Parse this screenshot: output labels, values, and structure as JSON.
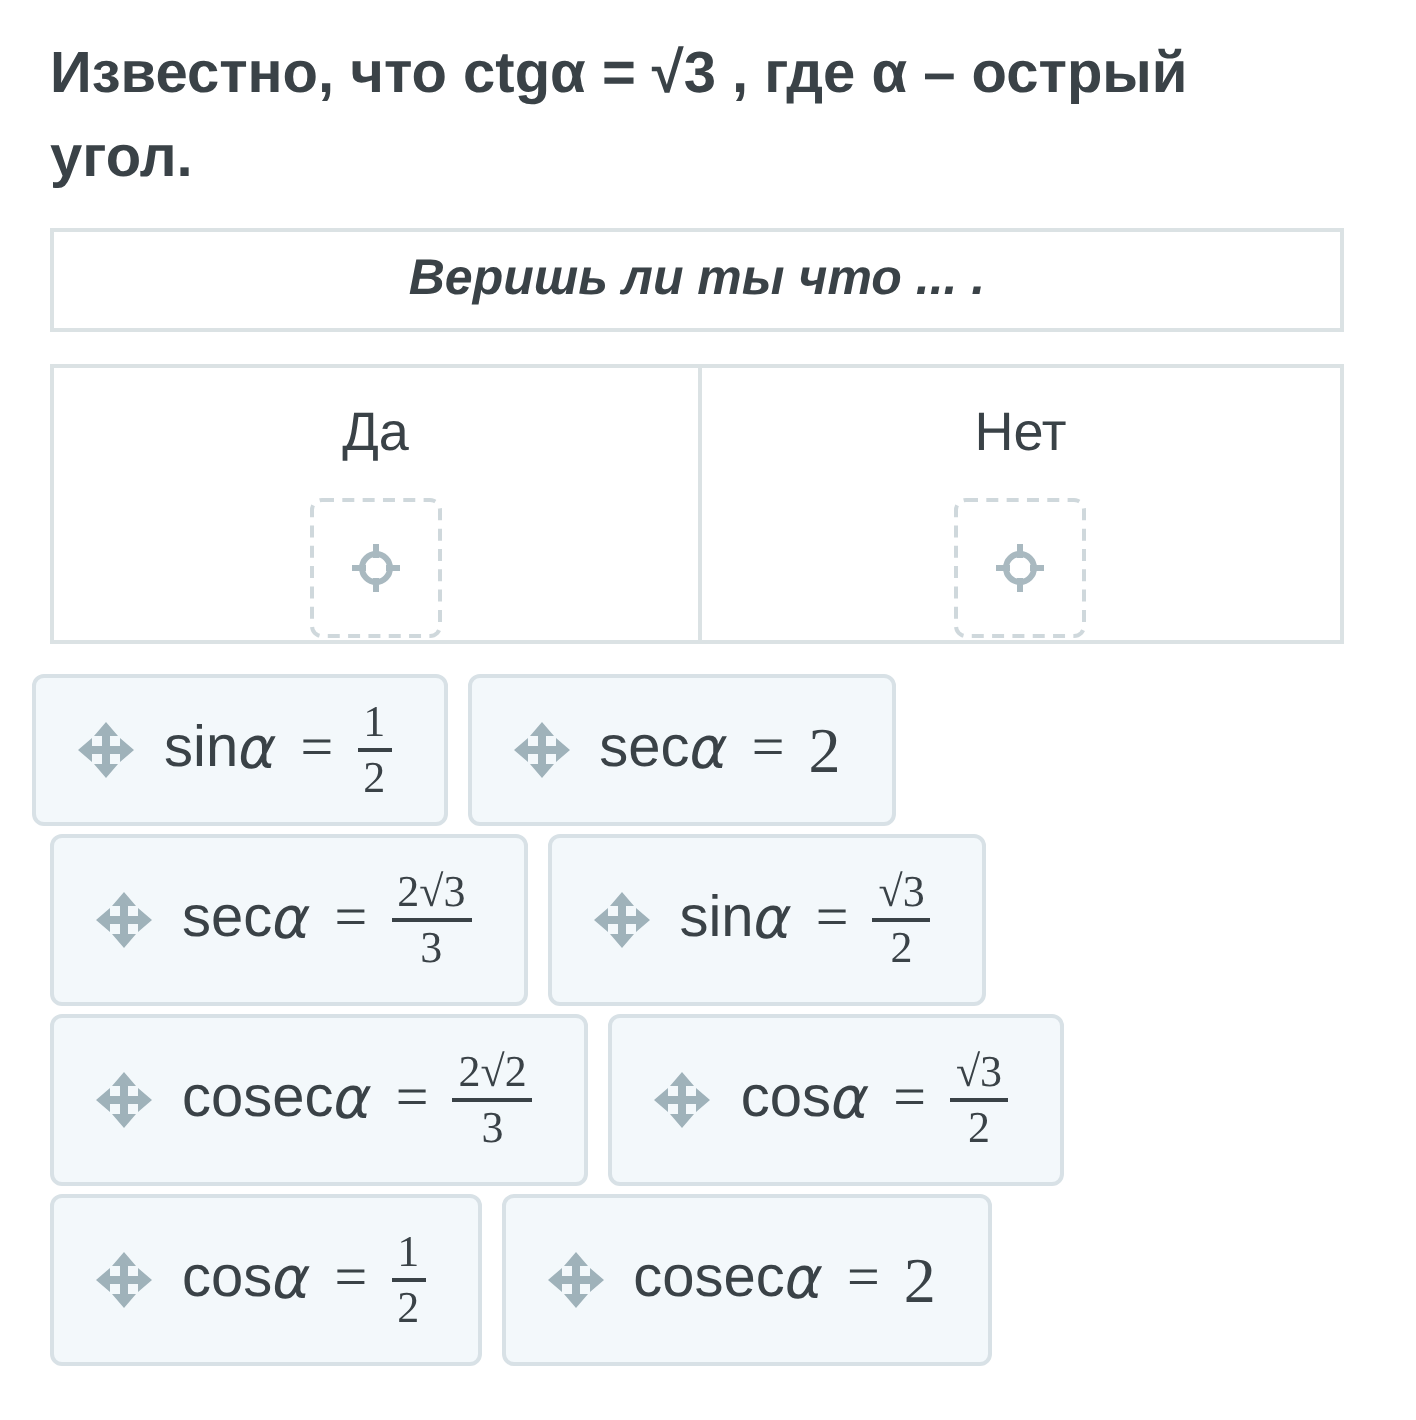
{
  "question": "Известно, что ctgα = √3 , где α – острый угол.",
  "prompt": "Веришь ли ты что ... .",
  "columns": [
    {
      "label": "Да"
    },
    {
      "label": "Нет"
    }
  ],
  "cards": [
    {
      "func": "sin",
      "var": "α",
      "rel": "=",
      "rhs": {
        "kind": "fraction",
        "numerator": "1",
        "denominator": "2"
      }
    },
    {
      "func": "sec",
      "var": "α",
      "rel": "=",
      "rhs": {
        "kind": "number",
        "text": "2"
      }
    },
    {
      "func": "sec",
      "var": "α",
      "rel": "=",
      "rhs": {
        "kind": "fraction",
        "numerator": "2√3",
        "denominator": "3"
      }
    },
    {
      "func": "sin",
      "var": "α",
      "rel": "=",
      "rhs": {
        "kind": "fraction",
        "numerator": "√3",
        "denominator": "2"
      }
    },
    {
      "func": "cosec",
      "var": "α",
      "rel": "=",
      "rhs": {
        "kind": "fraction",
        "numerator": "2√2",
        "denominator": "3"
      }
    },
    {
      "func": "cos",
      "var": "α",
      "rel": "=",
      "rhs": {
        "kind": "fraction",
        "numerator": "√3",
        "denominator": "2"
      }
    },
    {
      "func": "cos",
      "var": "α",
      "rel": "=",
      "rhs": {
        "kind": "fraction",
        "numerator": "1",
        "denominator": "2"
      }
    },
    {
      "func": "cosec",
      "var": "α",
      "rel": "=",
      "rhs": {
        "kind": "number",
        "text": "2"
      }
    }
  ]
}
